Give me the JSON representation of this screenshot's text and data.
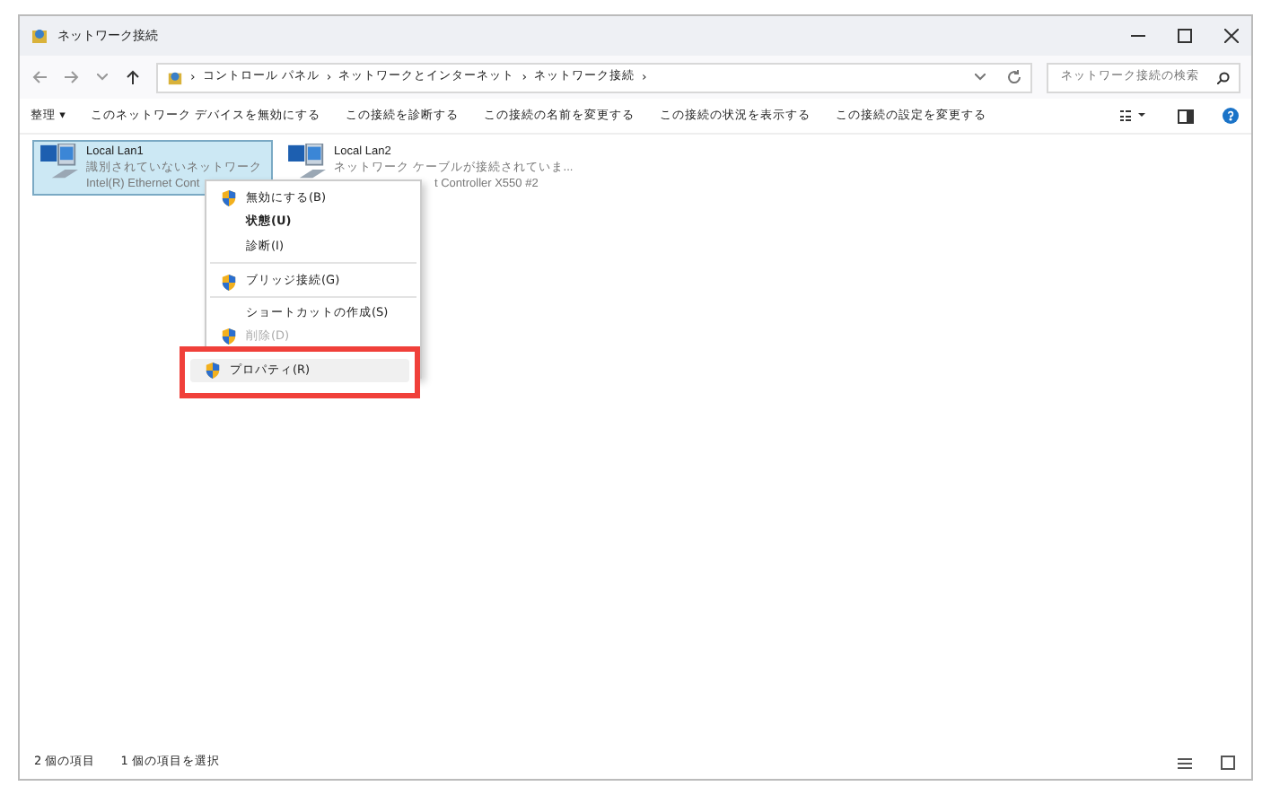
{
  "window": {
    "title": "ネットワーク接続"
  },
  "address": {
    "separator": "›",
    "path": [
      "コントロール パネル",
      "ネットワークとインターネット",
      "ネットワーク接続"
    ],
    "search_placeholder": "ネットワーク接続の検索"
  },
  "commands": [
    "整理 ▾",
    "このネットワーク デバイスを無効にする",
    "この接続を診断する",
    "この接続の名前を変更する",
    "この接続の状況を表示する",
    "この接続の設定を変更する"
  ],
  "connections": [
    {
      "name": "Local Lan1",
      "status": "識別されていないネットワーク",
      "device": "Intel(R) Ethernet Cont",
      "selected": true
    },
    {
      "name": "Local Lan2",
      "status": "ネットワーク ケーブルが接続されていま...",
      "device": "t Controller X550 #2",
      "selected": false
    }
  ],
  "context_menu": [
    {
      "label": "無効にする(B)",
      "shield": true,
      "bold": false,
      "disabled": false,
      "separator_after": false
    },
    {
      "label": "状態(U)",
      "shield": false,
      "bold": true,
      "disabled": false,
      "separator_after": false
    },
    {
      "label": "診断(I)",
      "shield": false,
      "bold": false,
      "disabled": false,
      "separator_after": true
    },
    {
      "label": "ブリッジ接続(G)",
      "shield": true,
      "bold": false,
      "disabled": false,
      "separator_after": true
    },
    {
      "label": "ショートカットの作成(S)",
      "shield": false,
      "bold": false,
      "disabled": false,
      "separator_after": false
    },
    {
      "label": "削除(D)",
      "shield": true,
      "bold": false,
      "disabled": true,
      "separator_after": false
    }
  ],
  "highlighted_item": {
    "label": "プロパティ(R)",
    "shield": true
  },
  "status_bar": [
    "2 個の項目",
    "1 個の項目を選択"
  ]
}
